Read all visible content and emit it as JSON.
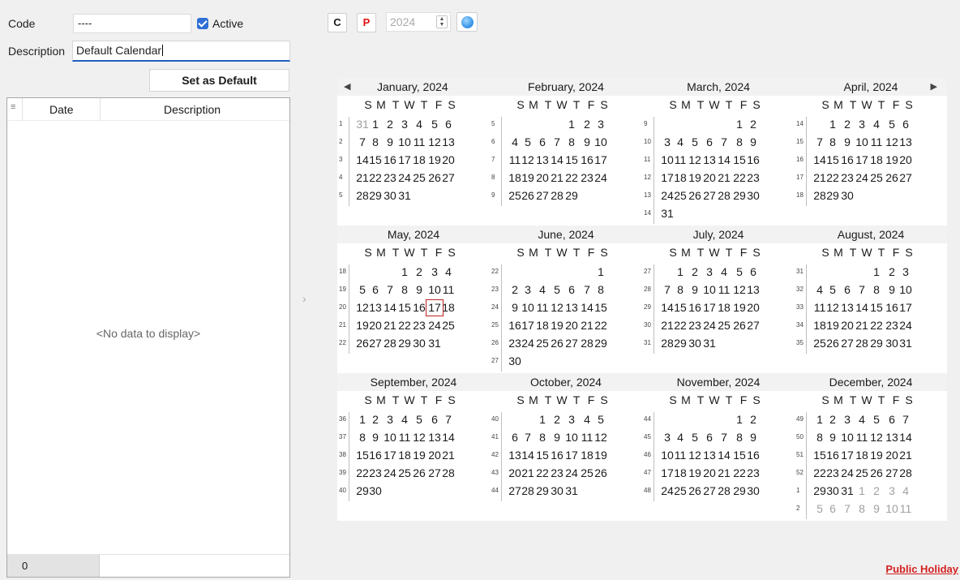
{
  "form": {
    "code_label": "Code",
    "code_value": "----",
    "active_label": "Active",
    "description_label": "Description",
    "description_value": "Default Calendar",
    "set_default_label": "Set as Default"
  },
  "grid": {
    "col_date": "Date",
    "col_description": "Description",
    "empty_text": "<No data to display>",
    "footer_count": "0"
  },
  "toolbar": {
    "c_label": "C",
    "p_label": "P",
    "year": "2024",
    "c_color": "#222222",
    "p_color": "#e01010"
  },
  "colors": {
    "today_border": "#bb2222",
    "holiday": "#d32020",
    "active_check": "#2f6fd6"
  },
  "calendar": {
    "dow": [
      "S",
      "M",
      "T",
      "W",
      "T",
      "F",
      "S"
    ],
    "months": [
      {
        "title": "January, 2024",
        "weeks": [
          {
            "wk": "1",
            "days": [
              "31",
              "1",
              "2",
              "3",
              "4",
              "5",
              "6"
            ],
            "other": [
              0
            ]
          },
          {
            "wk": "2",
            "days": [
              "7",
              "8",
              "9",
              "10",
              "11",
              "12",
              "13"
            ]
          },
          {
            "wk": "3",
            "days": [
              "14",
              "15",
              "16",
              "17",
              "18",
              "19",
              "20"
            ]
          },
          {
            "wk": "4",
            "days": [
              "21",
              "22",
              "23",
              "24",
              "25",
              "26",
              "27"
            ]
          },
          {
            "wk": "5",
            "days": [
              "28",
              "29",
              "30",
              "31",
              "",
              "",
              ""
            ]
          }
        ]
      },
      {
        "title": "February, 2024",
        "weeks": [
          {
            "wk": "5",
            "days": [
              "",
              "",
              "",
              "",
              "1",
              "2",
              "3"
            ]
          },
          {
            "wk": "6",
            "days": [
              "4",
              "5",
              "6",
              "7",
              "8",
              "9",
              "10"
            ]
          },
          {
            "wk": "7",
            "days": [
              "11",
              "12",
              "13",
              "14",
              "15",
              "16",
              "17"
            ]
          },
          {
            "wk": "8",
            "days": [
              "18",
              "19",
              "20",
              "21",
              "22",
              "23",
              "24"
            ]
          },
          {
            "wk": "9",
            "days": [
              "25",
              "26",
              "27",
              "28",
              "29",
              "",
              ""
            ]
          }
        ]
      },
      {
        "title": "March, 2024",
        "weeks": [
          {
            "wk": "9",
            "days": [
              "",
              "",
              "",
              "",
              "",
              "1",
              "2"
            ]
          },
          {
            "wk": "10",
            "days": [
              "3",
              "4",
              "5",
              "6",
              "7",
              "8",
              "9"
            ]
          },
          {
            "wk": "11",
            "days": [
              "10",
              "11",
              "12",
              "13",
              "14",
              "15",
              "16"
            ]
          },
          {
            "wk": "12",
            "days": [
              "17",
              "18",
              "19",
              "20",
              "21",
              "22",
              "23"
            ]
          },
          {
            "wk": "13",
            "days": [
              "24",
              "25",
              "26",
              "27",
              "28",
              "29",
              "30"
            ]
          },
          {
            "wk": "14",
            "days": [
              "31",
              "",
              "",
              "",
              "",
              "",
              ""
            ]
          }
        ]
      },
      {
        "title": "April, 2024",
        "weeks": [
          {
            "wk": "14",
            "days": [
              "",
              "1",
              "2",
              "3",
              "4",
              "5",
              "6"
            ]
          },
          {
            "wk": "15",
            "days": [
              "7",
              "8",
              "9",
              "10",
              "11",
              "12",
              "13"
            ]
          },
          {
            "wk": "16",
            "days": [
              "14",
              "15",
              "16",
              "17",
              "18",
              "19",
              "20"
            ]
          },
          {
            "wk": "17",
            "days": [
              "21",
              "22",
              "23",
              "24",
              "25",
              "26",
              "27"
            ]
          },
          {
            "wk": "18",
            "days": [
              "28",
              "29",
              "30",
              "",
              "",
              "",
              ""
            ]
          }
        ]
      },
      {
        "title": "May, 2024",
        "weeks": [
          {
            "wk": "18",
            "days": [
              "",
              "",
              "",
              "1",
              "2",
              "3",
              "4"
            ]
          },
          {
            "wk": "19",
            "days": [
              "5",
              "6",
              "7",
              "8",
              "9",
              "10",
              "11"
            ]
          },
          {
            "wk": "20",
            "days": [
              "12",
              "13",
              "14",
              "15",
              "16",
              "17",
              "18"
            ],
            "today": 5
          },
          {
            "wk": "21",
            "days": [
              "19",
              "20",
              "21",
              "22",
              "23",
              "24",
              "25"
            ]
          },
          {
            "wk": "22",
            "days": [
              "26",
              "27",
              "28",
              "29",
              "30",
              "31",
              ""
            ]
          }
        ]
      },
      {
        "title": "June, 2024",
        "weeks": [
          {
            "wk": "22",
            "days": [
              "",
              "",
              "",
              "",
              "",
              "",
              "1"
            ]
          },
          {
            "wk": "23",
            "days": [
              "2",
              "3",
              "4",
              "5",
              "6",
              "7",
              "8"
            ]
          },
          {
            "wk": "24",
            "days": [
              "9",
              "10",
              "11",
              "12",
              "13",
              "14",
              "15"
            ]
          },
          {
            "wk": "25",
            "days": [
              "16",
              "17",
              "18",
              "19",
              "20",
              "21",
              "22"
            ]
          },
          {
            "wk": "26",
            "days": [
              "23",
              "24",
              "25",
              "26",
              "27",
              "28",
              "29"
            ]
          },
          {
            "wk": "27",
            "days": [
              "30",
              "",
              "",
              "",
              "",
              "",
              ""
            ]
          }
        ]
      },
      {
        "title": "July, 2024",
        "weeks": [
          {
            "wk": "27",
            "days": [
              "",
              "1",
              "2",
              "3",
              "4",
              "5",
              "6"
            ]
          },
          {
            "wk": "28",
            "days": [
              "7",
              "8",
              "9",
              "10",
              "11",
              "12",
              "13"
            ]
          },
          {
            "wk": "29",
            "days": [
              "14",
              "15",
              "16",
              "17",
              "18",
              "19",
              "20"
            ]
          },
          {
            "wk": "30",
            "days": [
              "21",
              "22",
              "23",
              "24",
              "25",
              "26",
              "27"
            ]
          },
          {
            "wk": "31",
            "days": [
              "28",
              "29",
              "30",
              "31",
              "",
              "",
              ""
            ]
          }
        ]
      },
      {
        "title": "August, 2024",
        "weeks": [
          {
            "wk": "31",
            "days": [
              "",
              "",
              "",
              "",
              "1",
              "2",
              "3"
            ]
          },
          {
            "wk": "32",
            "days": [
              "4",
              "5",
              "6",
              "7",
              "8",
              "9",
              "10"
            ]
          },
          {
            "wk": "33",
            "days": [
              "11",
              "12",
              "13",
              "14",
              "15",
              "16",
              "17"
            ]
          },
          {
            "wk": "34",
            "days": [
              "18",
              "19",
              "20",
              "21",
              "22",
              "23",
              "24"
            ]
          },
          {
            "wk": "35",
            "days": [
              "25",
              "26",
              "27",
              "28",
              "29",
              "30",
              "31"
            ]
          }
        ]
      },
      {
        "title": "September, 2024",
        "weeks": [
          {
            "wk": "36",
            "days": [
              "1",
              "2",
              "3",
              "4",
              "5",
              "6",
              "7"
            ]
          },
          {
            "wk": "37",
            "days": [
              "8",
              "9",
              "10",
              "11",
              "12",
              "13",
              "14"
            ]
          },
          {
            "wk": "38",
            "days": [
              "15",
              "16",
              "17",
              "18",
              "19",
              "20",
              "21"
            ]
          },
          {
            "wk": "39",
            "days": [
              "22",
              "23",
              "24",
              "25",
              "26",
              "27",
              "28"
            ]
          },
          {
            "wk": "40",
            "days": [
              "29",
              "30",
              "",
              "",
              "",
              "",
              ""
            ]
          }
        ]
      },
      {
        "title": "October, 2024",
        "weeks": [
          {
            "wk": "40",
            "days": [
              "",
              "",
              "1",
              "2",
              "3",
              "4",
              "5"
            ]
          },
          {
            "wk": "41",
            "days": [
              "6",
              "7",
              "8",
              "9",
              "10",
              "11",
              "12"
            ]
          },
          {
            "wk": "42",
            "days": [
              "13",
              "14",
              "15",
              "16",
              "17",
              "18",
              "19"
            ]
          },
          {
            "wk": "43",
            "days": [
              "20",
              "21",
              "22",
              "23",
              "24",
              "25",
              "26"
            ]
          },
          {
            "wk": "44",
            "days": [
              "27",
              "28",
              "29",
              "30",
              "31",
              "",
              ""
            ]
          }
        ]
      },
      {
        "title": "November, 2024",
        "weeks": [
          {
            "wk": "44",
            "days": [
              "",
              "",
              "",
              "",
              "",
              "1",
              "2"
            ]
          },
          {
            "wk": "45",
            "days": [
              "3",
              "4",
              "5",
              "6",
              "7",
              "8",
              "9"
            ]
          },
          {
            "wk": "46",
            "days": [
              "10",
              "11",
              "12",
              "13",
              "14",
              "15",
              "16"
            ]
          },
          {
            "wk": "47",
            "days": [
              "17",
              "18",
              "19",
              "20",
              "21",
              "22",
              "23"
            ]
          },
          {
            "wk": "48",
            "days": [
              "24",
              "25",
              "26",
              "27",
              "28",
              "29",
              "30"
            ]
          }
        ]
      },
      {
        "title": "December, 2024",
        "weeks": [
          {
            "wk": "49",
            "days": [
              "1",
              "2",
              "3",
              "4",
              "5",
              "6",
              "7"
            ]
          },
          {
            "wk": "50",
            "days": [
              "8",
              "9",
              "10",
              "11",
              "12",
              "13",
              "14"
            ]
          },
          {
            "wk": "51",
            "days": [
              "15",
              "16",
              "17",
              "18",
              "19",
              "20",
              "21"
            ]
          },
          {
            "wk": "52",
            "days": [
              "22",
              "23",
              "24",
              "25",
              "26",
              "27",
              "28"
            ]
          },
          {
            "wk": "1",
            "days": [
              "29",
              "30",
              "31",
              "1",
              "2",
              "3",
              "4"
            ],
            "other": [
              3,
              4,
              5,
              6
            ]
          },
          {
            "wk": "2",
            "days": [
              "5",
              "6",
              "7",
              "8",
              "9",
              "10",
              "11"
            ],
            "other": [
              0,
              1,
              2,
              3,
              4,
              5,
              6
            ]
          }
        ]
      }
    ]
  },
  "legend": {
    "public_holiday": "Public Holiday"
  }
}
